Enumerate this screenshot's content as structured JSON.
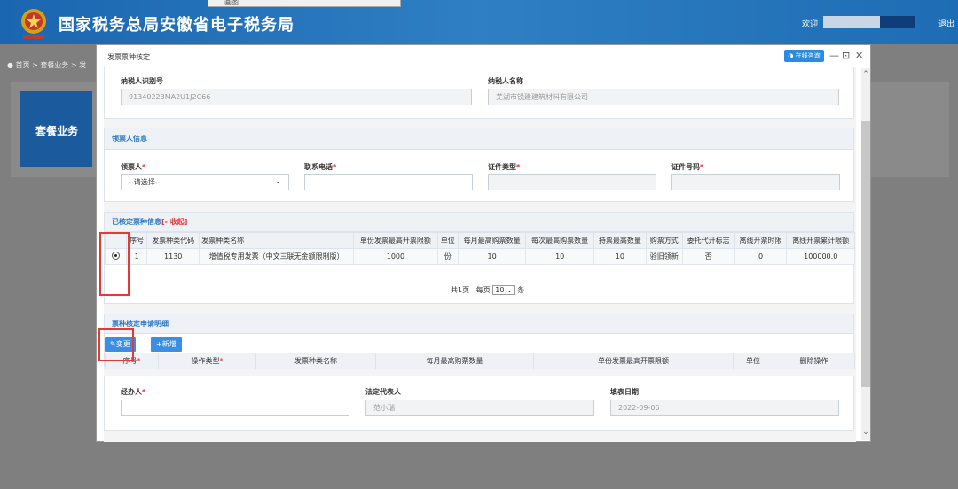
{
  "header": {
    "site_title": "国家税务总局安徽省电子税务局",
    "welcome": "欢迎",
    "logout": "退出",
    "top_popup": "画图"
  },
  "background": {
    "breadcrumb": "首页 > 套餐业务 > 发",
    "tile_label": "套餐业务"
  },
  "modal": {
    "title": "发票票种核定",
    "online_button": "在线咨询",
    "minimize": "—",
    "maximize": "⊡",
    "close": "✕",
    "taxpayer": {
      "id_label": "纳税人识别号",
      "id_value": "91340223MA2U1J2C66",
      "name_label": "纳税人名称",
      "name_value": "芜湖市锐建建筑材料有限公司"
    },
    "receiver": {
      "section_title": "领票人信息",
      "receiver_label": "领票人",
      "receiver_placeholder": "--请选择--",
      "phone_label": "联系电话",
      "cert_type_label": "证件类型",
      "cert_no_label": "证件号码"
    },
    "approved": {
      "section_title": "已核定票种信息",
      "collapse_link": "[- 收起]",
      "columns": [
        "序号",
        "发票种类代码",
        "发票种类名称",
        "单份发票最高开票限额",
        "单位",
        "每月最高购票数量",
        "每次最高购票数量",
        "持票最高数量",
        "购票方式",
        "委托代开标志",
        "离线开票时限",
        "离线开票累计限额"
      ],
      "rows": [
        [
          "1",
          "1130",
          "增值税专用发票（中文三联无金额限制版）",
          "1000",
          "份",
          "10",
          "10",
          "10",
          "验旧领新",
          "否",
          "0",
          "100000.0"
        ]
      ],
      "pager": {
        "total": "共1页",
        "per_page_label": "每页",
        "per_page_value": "10",
        "unit": "条"
      }
    },
    "detail": {
      "section_title": "票种核定申请明细",
      "change_button": "变更",
      "add_button": "新增",
      "columns": [
        "序号",
        "操作类型",
        "发票种类名称",
        "每月最高购票数量",
        "单份发票最高开票限额",
        "单位",
        "删除操作"
      ]
    },
    "agent": {
      "agent_label": "经办人",
      "legal_label": "法定代表人",
      "legal_value": "范小瑞",
      "date_label": "填表日期",
      "date_value": "2022-09-06"
    }
  },
  "colors": {
    "header_blue": "#1a66b0",
    "link_blue": "#2a74c0",
    "highlight_red": "#e53935",
    "button_blue": "#3a8ee6"
  }
}
